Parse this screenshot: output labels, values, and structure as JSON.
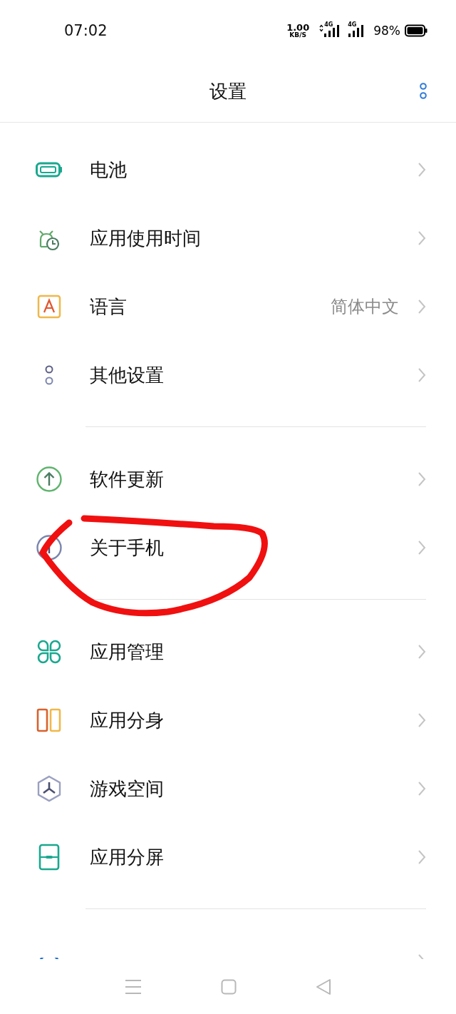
{
  "status_bar": {
    "time": "07:02",
    "speed_value": "1.00",
    "speed_unit": "KB/S",
    "networks": [
      {
        "label": "4G",
        "data_arrows": true
      },
      {
        "label": "4G",
        "data_arrows": false
      }
    ],
    "battery": "98%"
  },
  "header": {
    "title": "设置"
  },
  "groups": [
    {
      "items": [
        {
          "kind": "battery",
          "label": "电池"
        },
        {
          "kind": "timer",
          "label": "应用使用时间"
        },
        {
          "kind": "language",
          "label": "语言",
          "value": "简体中文"
        },
        {
          "kind": "other",
          "label": "其他设置"
        }
      ]
    },
    {
      "items": [
        {
          "kind": "update",
          "label": "软件更新"
        },
        {
          "kind": "about",
          "label": "关于手机"
        }
      ]
    },
    {
      "items": [
        {
          "kind": "apps",
          "label": "应用管理"
        },
        {
          "kind": "clone",
          "label": "应用分身"
        },
        {
          "kind": "game",
          "label": "游戏空间"
        },
        {
          "kind": "split",
          "label": "应用分屏"
        }
      ]
    },
    {
      "items": [
        {
          "kind": "cloud"
        }
      ]
    }
  ]
}
